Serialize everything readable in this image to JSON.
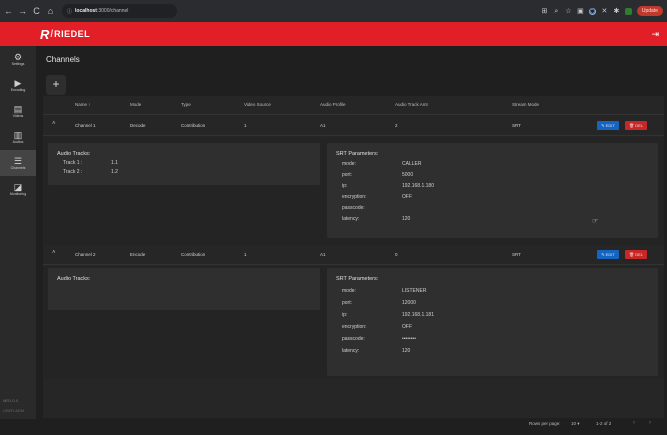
{
  "browser": {
    "address_prefix": "ⓘ",
    "address_host": "localhost",
    "address_path": ":3000/channel",
    "update_label": "Update"
  },
  "header": {
    "logo_r": "R",
    "logo_slash": "/",
    "logo_text": "RIEDEL"
  },
  "sidebar": {
    "items": [
      {
        "label": "Settings",
        "icon": "gear-icon"
      },
      {
        "label": "Encoding",
        "icon": "encoding-icon"
      },
      {
        "label": "Videos",
        "icon": "video-icon"
      },
      {
        "label": "Audios",
        "icon": "audio-icon"
      },
      {
        "label": "Channels",
        "icon": "channels-icon"
      },
      {
        "label": "Monitoring",
        "icon": "monitoring-icon"
      }
    ],
    "version": "MR1.0.0",
    "user": "USER.ADM"
  },
  "page": {
    "title": "Channels",
    "add_label": "+"
  },
  "table": {
    "headers": {
      "name": "Name ↑",
      "mode": "Mode",
      "type": "Type",
      "video_source": "Video Source",
      "audio_profile": "Audio Profile",
      "audio_track_amt": "Audio Track Amt",
      "stream_mode": "Stream Mode"
    },
    "rows": [
      {
        "name": "Channel 1",
        "mode": "Decode",
        "type": "Contribution",
        "video_source": "1",
        "audio_profile": "A1",
        "audio_track_amt": "2",
        "stream_mode": "SRT",
        "edit_label": "✎ EDIT",
        "delete_label": "🗑 DEL",
        "audio_panel_title": "Audio Tracks:",
        "audio_tracks": [
          {
            "key": "Track 1 :",
            "value": "1.1"
          },
          {
            "key": "Track 2 :",
            "value": "1.2"
          }
        ],
        "srt_title": "SRT Parameters:",
        "srt": [
          {
            "key": "mode:",
            "value": "CALLER"
          },
          {
            "key": "port:",
            "value": "5000"
          },
          {
            "key": "ip:",
            "value": "192.168.1.180"
          },
          {
            "key": "encryption:",
            "value": "OFF"
          },
          {
            "key": "passcode:",
            "value": ""
          },
          {
            "key": "latency:",
            "value": "120"
          }
        ]
      },
      {
        "name": "Channel 2",
        "mode": "Encode",
        "type": "Contribution",
        "video_source": "1",
        "audio_profile": "A1",
        "audio_track_amt": "0",
        "stream_mode": "SRT",
        "edit_label": "✎ EDIT",
        "delete_label": "🗑 DEL",
        "audio_panel_title": "Audio Tracks:",
        "audio_tracks": [],
        "srt_title": "SRT Parameters:",
        "srt": [
          {
            "key": "mode:",
            "value": "LISTENER"
          },
          {
            "key": "port:",
            "value": "12000"
          },
          {
            "key": "ip:",
            "value": "192.168.1.181"
          },
          {
            "key": "encryption:",
            "value": "OFF"
          },
          {
            "key": "passcode:",
            "value": "••••••••"
          },
          {
            "key": "latency:",
            "value": "120"
          }
        ]
      }
    ]
  },
  "footer": {
    "rows_per_page_label": "Rows per page:",
    "rows_per_page_value": "10 ▾",
    "range": "1-2 of 2",
    "prev": "‹",
    "next": "›"
  },
  "colors": {
    "brand_red": "#e21e26",
    "edit_blue": "#1565c0",
    "delete_red": "#c62828"
  }
}
